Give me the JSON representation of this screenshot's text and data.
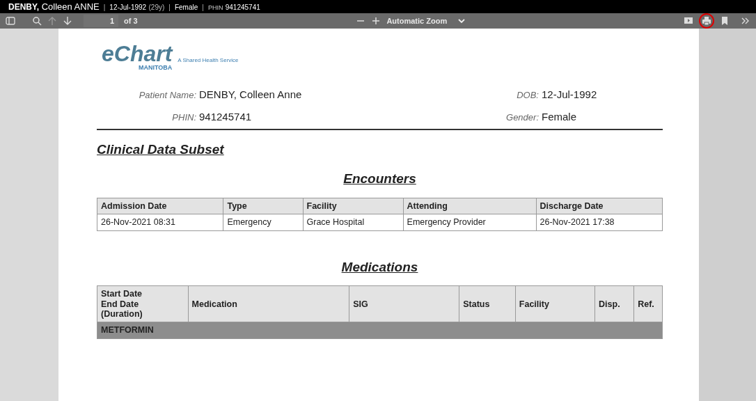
{
  "header": {
    "surname": "DENBY,",
    "given": "Colleen ANNE",
    "separator": "|",
    "dob": "12-Jul-1992",
    "age": "(29y)",
    "gender": "Female",
    "phin_label": "PHIN",
    "phin": "941245741"
  },
  "toolbar": {
    "page": "1",
    "page_count": "of 3",
    "zoom": "Automatic Zoom",
    "print_highlighted": true
  },
  "logo": {
    "brand": "eChart",
    "region": "MANITOBA",
    "tagline": "A Shared Health Service"
  },
  "patient": [
    {
      "label": "Patient Name:",
      "value": "DENBY, Colleen Anne"
    },
    {
      "label": "DOB:",
      "value": "12-Jul-1992"
    },
    {
      "label": "PHIN:",
      "value": "941245741"
    },
    {
      "label": "Gender:",
      "value": "Female"
    }
  ],
  "section_title": "Clinical Data Subset",
  "encounters": {
    "title": "Encounters",
    "columns": [
      "Admission Date",
      "Type",
      "Facility",
      "Attending",
      "Discharge Date"
    ],
    "rows": [
      [
        "26-Nov-2021 08:31",
        "Emergency",
        "Grace Hospital",
        "Emergency Provider",
        "26-Nov-2021 17:38"
      ]
    ]
  },
  "medications": {
    "title": "Medications",
    "columns": [
      "Start Date\nEnd Date\n(Duration)",
      "Medication",
      "SIG",
      "Status",
      "Facility",
      "Disp.",
      "Ref."
    ],
    "groups": [
      {
        "name": "METFORMIN"
      }
    ]
  }
}
